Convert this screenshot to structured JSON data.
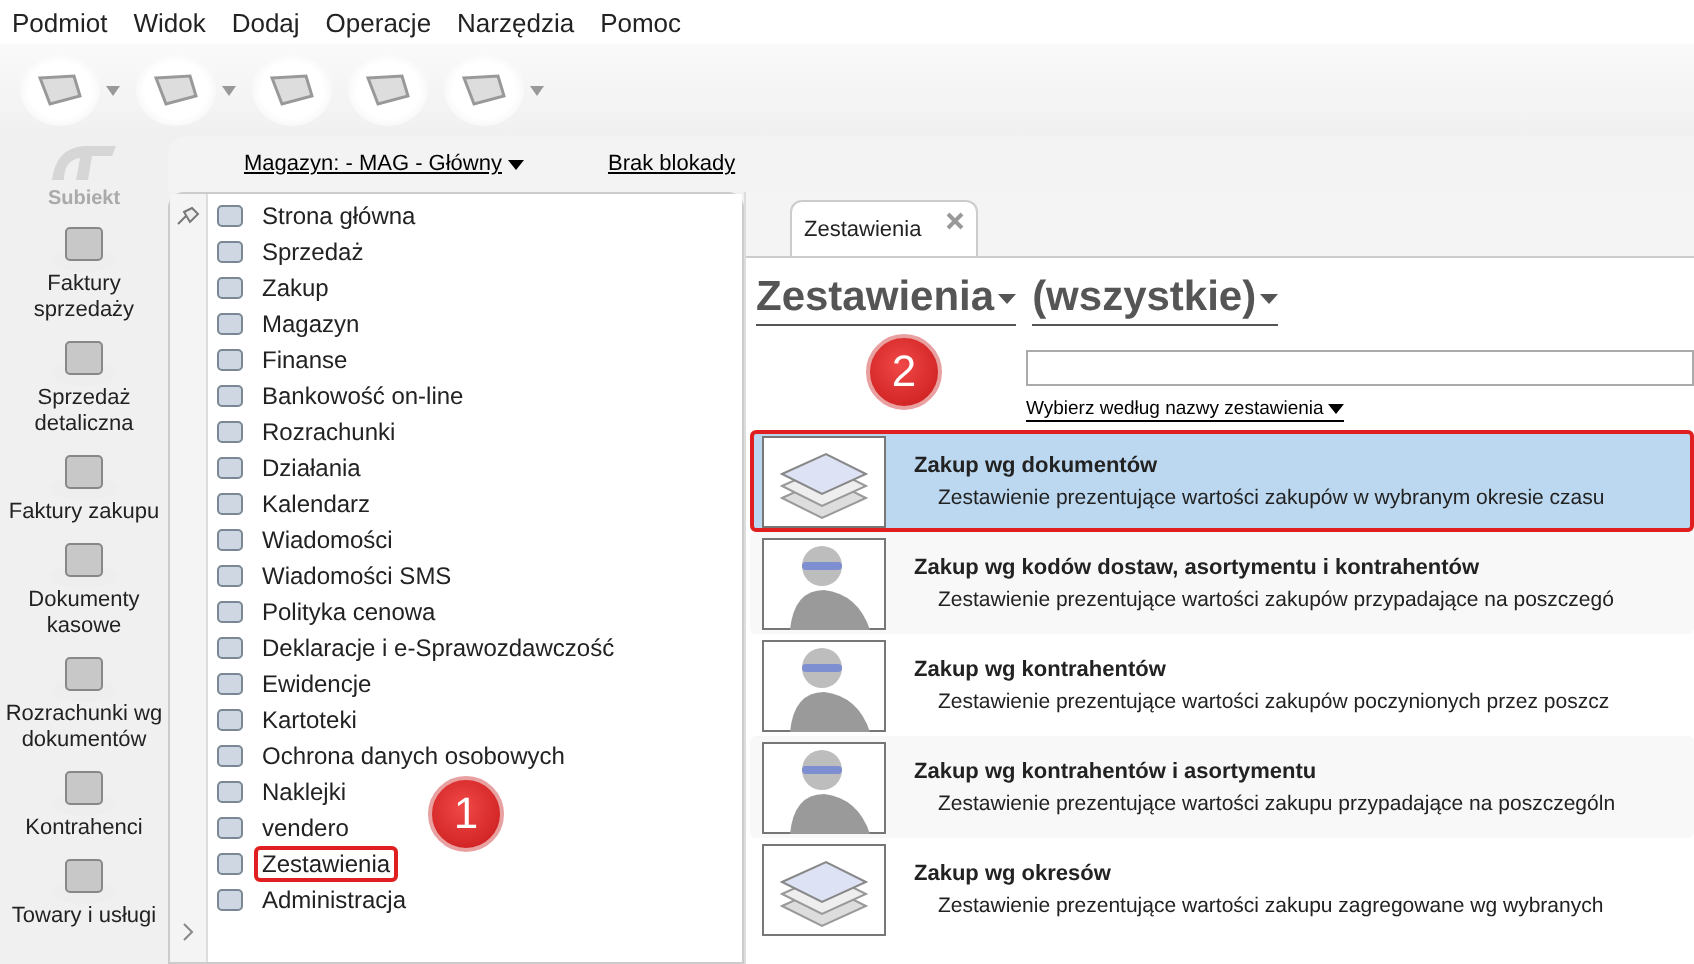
{
  "menu": [
    "Podmiot",
    "Widok",
    "Dodaj",
    "Operacje",
    "Narzędzia",
    "Pomoc"
  ],
  "toolbar": [
    {
      "has_menu": true
    },
    {
      "has_menu": true
    },
    {
      "has_menu": false
    },
    {
      "has_menu": false
    },
    {
      "has_menu": true
    }
  ],
  "app_logo": "Subiekt",
  "shortcuts": [
    "Faktury sprzedaży",
    "Sprzedaż detaliczna",
    "Faktury zakupu",
    "Dokumenty kasowe",
    "Rozrachunki wg dokumentów",
    "Kontrahenci",
    "Towary i usługi"
  ],
  "context_bar": {
    "warehouse": "Magazyn: - MAG - Główny",
    "lock": "Brak blokady"
  },
  "modules": [
    {
      "label": "Strona główna",
      "highlighted": false
    },
    {
      "label": "Sprzedaż",
      "highlighted": false
    },
    {
      "label": "Zakup",
      "highlighted": false
    },
    {
      "label": "Magazyn",
      "highlighted": false
    },
    {
      "label": "Finanse",
      "highlighted": false
    },
    {
      "label": "Bankowość on-line",
      "highlighted": false
    },
    {
      "label": "Rozrachunki",
      "highlighted": false
    },
    {
      "label": "Działania",
      "highlighted": false
    },
    {
      "label": "Kalendarz",
      "highlighted": false
    },
    {
      "label": "Wiadomości",
      "highlighted": false
    },
    {
      "label": "Wiadomości SMS",
      "highlighted": false
    },
    {
      "label": "Polityka cenowa",
      "highlighted": false
    },
    {
      "label": "Deklaracje i e-Sprawozdawczość",
      "highlighted": false
    },
    {
      "label": "Ewidencje",
      "highlighted": false
    },
    {
      "label": "Kartoteki",
      "highlighted": false
    },
    {
      "label": "Ochrona danych osobowych",
      "highlighted": false
    },
    {
      "label": "Naklejki",
      "highlighted": false
    },
    {
      "label": "vendero",
      "highlighted": false
    },
    {
      "label": "Zestawienia",
      "highlighted": true
    },
    {
      "label": "Administracja",
      "highlighted": false
    }
  ],
  "nav_callout": "1",
  "tabs": [
    {
      "label": "Zestawienia",
      "selected": true
    }
  ],
  "heading": {
    "category": "Zestawienia",
    "filter": "(wszystkie)"
  },
  "search_mode": "Wybierz według nazwy zestawienia",
  "list_callout": "2",
  "reports": [
    {
      "kind": "documents",
      "title": "Zakup wg dokumentów",
      "description": "Zestawienie prezentujące wartości zakupów w wybranym okresie czasu",
      "selected": true,
      "highlighted": true
    },
    {
      "kind": "person",
      "title": "Zakup wg kodów dostaw, asortymentu i kontrahentów",
      "description": "Zestawienie prezentujące wartości zakupów przypadające na poszczegó",
      "selected": false,
      "highlighted": false
    },
    {
      "kind": "person",
      "title": "Zakup wg kontrahentów",
      "description": "Zestawienie prezentujące wartości zakupów poczynionych przez poszcz",
      "selected": false,
      "highlighted": false
    },
    {
      "kind": "person",
      "title": "Zakup wg kontrahentów i asortymentu",
      "description": "Zestawienie prezentujące wartości zakupu przypadające na poszczególn",
      "selected": false,
      "highlighted": false
    },
    {
      "kind": "documents",
      "title": "Zakup wg okresów",
      "description": "Zestawienie prezentujące wartości zakupu zagregowane wg wybranych",
      "selected": false,
      "highlighted": false
    }
  ]
}
